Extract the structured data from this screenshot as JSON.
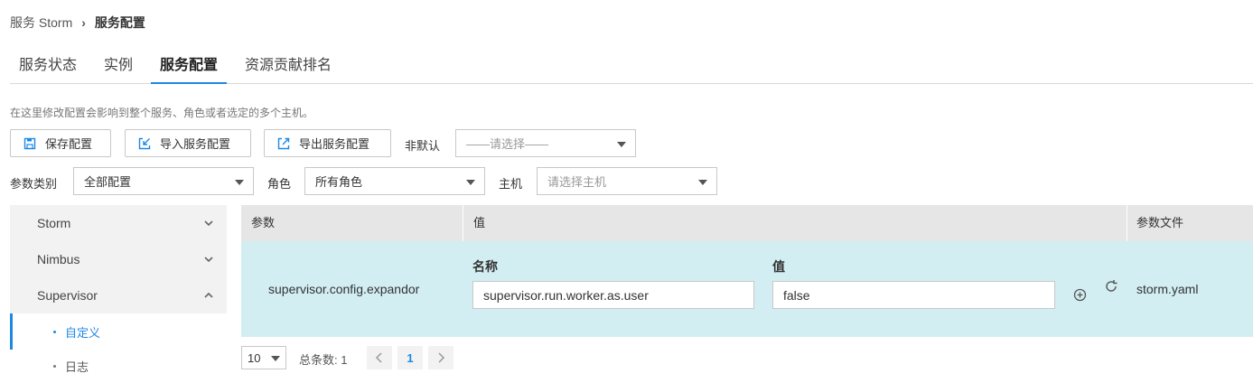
{
  "breadcrumb": {
    "parent": "服务 Storm",
    "separator": "›",
    "current": "服务配置"
  },
  "tabs": [
    {
      "label": "服务状态",
      "active": false
    },
    {
      "label": "实例",
      "active": false
    },
    {
      "label": "服务配置",
      "active": true
    },
    {
      "label": "资源贡献排名",
      "active": false
    }
  ],
  "hint": "在这里修改配置会影响到整个服务、角色或者选定的多个主机。",
  "toolbar": {
    "save_label": "保存配置",
    "import_label": "导入服务配置",
    "export_label": "导出服务配置",
    "non_default_label": "非默认",
    "non_default_placeholder": "——请选择——"
  },
  "filters": {
    "category_label": "参数类别",
    "category_value": "全部配置",
    "role_label": "角色",
    "role_value": "所有角色",
    "host_label": "主机",
    "host_placeholder": "请选择主机"
  },
  "sidebar": {
    "items": [
      {
        "label": "Storm",
        "expanded": false
      },
      {
        "label": "Nimbus",
        "expanded": false
      },
      {
        "label": "Supervisor",
        "expanded": true
      }
    ],
    "subitems": [
      {
        "label": "自定义",
        "active": true
      },
      {
        "label": "日志",
        "active": false
      }
    ]
  },
  "table": {
    "headers": {
      "param": "参数",
      "value": "值",
      "file": "参数文件"
    },
    "rows": [
      {
        "param": "supervisor.config.expandor",
        "name_label": "名称",
        "value_label": "值",
        "name_value": "supervisor.run.worker.as.user",
        "value_value": "false",
        "file": "storm.yaml"
      }
    ]
  },
  "pagination": {
    "page_size": "10",
    "total_label": "总条数: 1",
    "current_page": "1"
  },
  "colors": {
    "accent": "#1e88e5",
    "row_highlight": "#d2eef2",
    "header_bg": "#e6e6e6",
    "sidebar_bg": "#f2f2f2"
  }
}
